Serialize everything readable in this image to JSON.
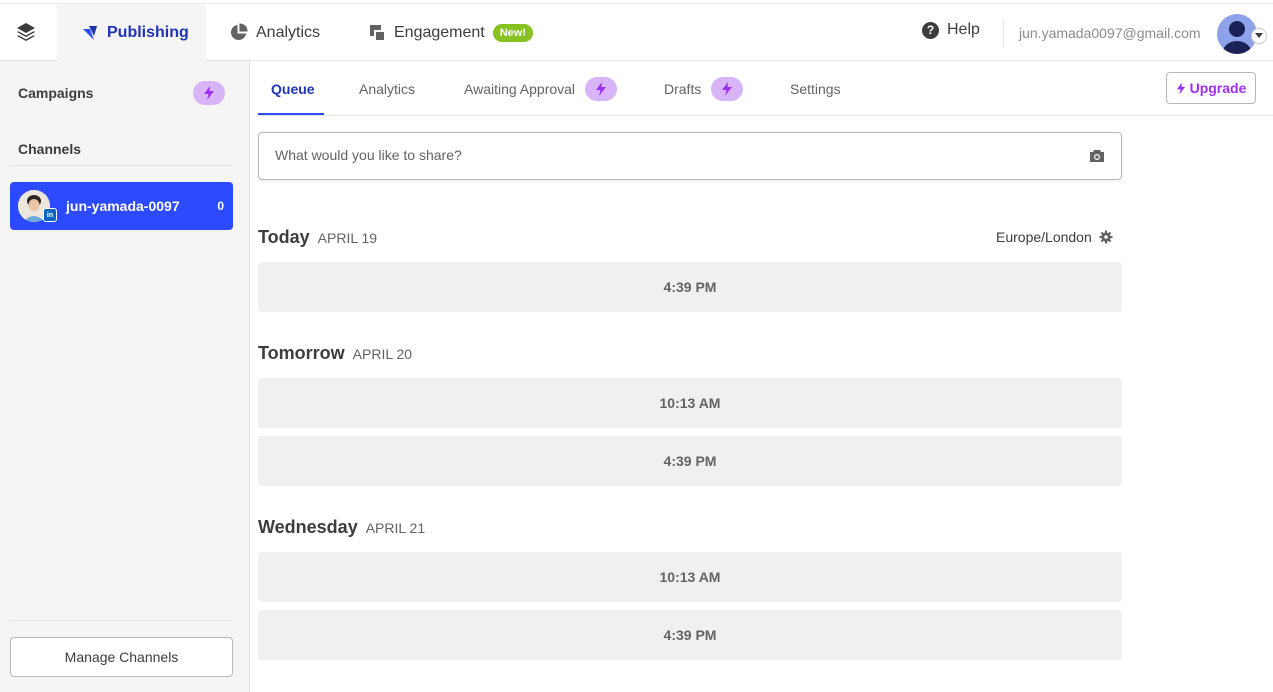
{
  "topnav": {
    "publishing": "Publishing",
    "analytics": "Analytics",
    "engagement": "Engagement",
    "engagement_badge": "New!",
    "help": "Help",
    "email": "jun.yamada0097@gmail.com"
  },
  "sidebar": {
    "campaigns": "Campaigns",
    "channels": "Channels",
    "channel": {
      "name": "jun-yamada-0097",
      "count": "0",
      "network_badge": "in"
    },
    "manage_channels": "Manage Channels"
  },
  "tabs": {
    "queue": "Queue",
    "analytics": "Analytics",
    "awaiting_approval": "Awaiting Approval",
    "drafts": "Drafts",
    "settings": "Settings",
    "upgrade": "Upgrade"
  },
  "composer": {
    "placeholder": "What would you like to share?"
  },
  "timezone": "Europe/London",
  "days": [
    {
      "name": "Today",
      "date": "APRIL 19",
      "slots": [
        "4:39 PM"
      ]
    },
    {
      "name": "Tomorrow",
      "date": "APRIL 20",
      "slots": [
        "10:13 AM",
        "4:39 PM"
      ]
    },
    {
      "name": "Wednesday",
      "date": "APRIL 21",
      "slots": [
        "10:13 AM",
        "4:39 PM"
      ]
    }
  ],
  "colors": {
    "brand_blue": "#2c4bff",
    "nav_active": "#1f35b3",
    "upgrade_purple": "#9d2ff0",
    "new_badge": "#87c221",
    "bolt_pill": "#d8b4f8"
  },
  "icons": [
    "layers-icon",
    "publishing-logo-icon",
    "pie-chart-icon",
    "engagement-icon",
    "help-icon",
    "bolt-icon",
    "camera-icon",
    "gear-icon",
    "caret-down-icon",
    "linkedin-icon"
  ]
}
